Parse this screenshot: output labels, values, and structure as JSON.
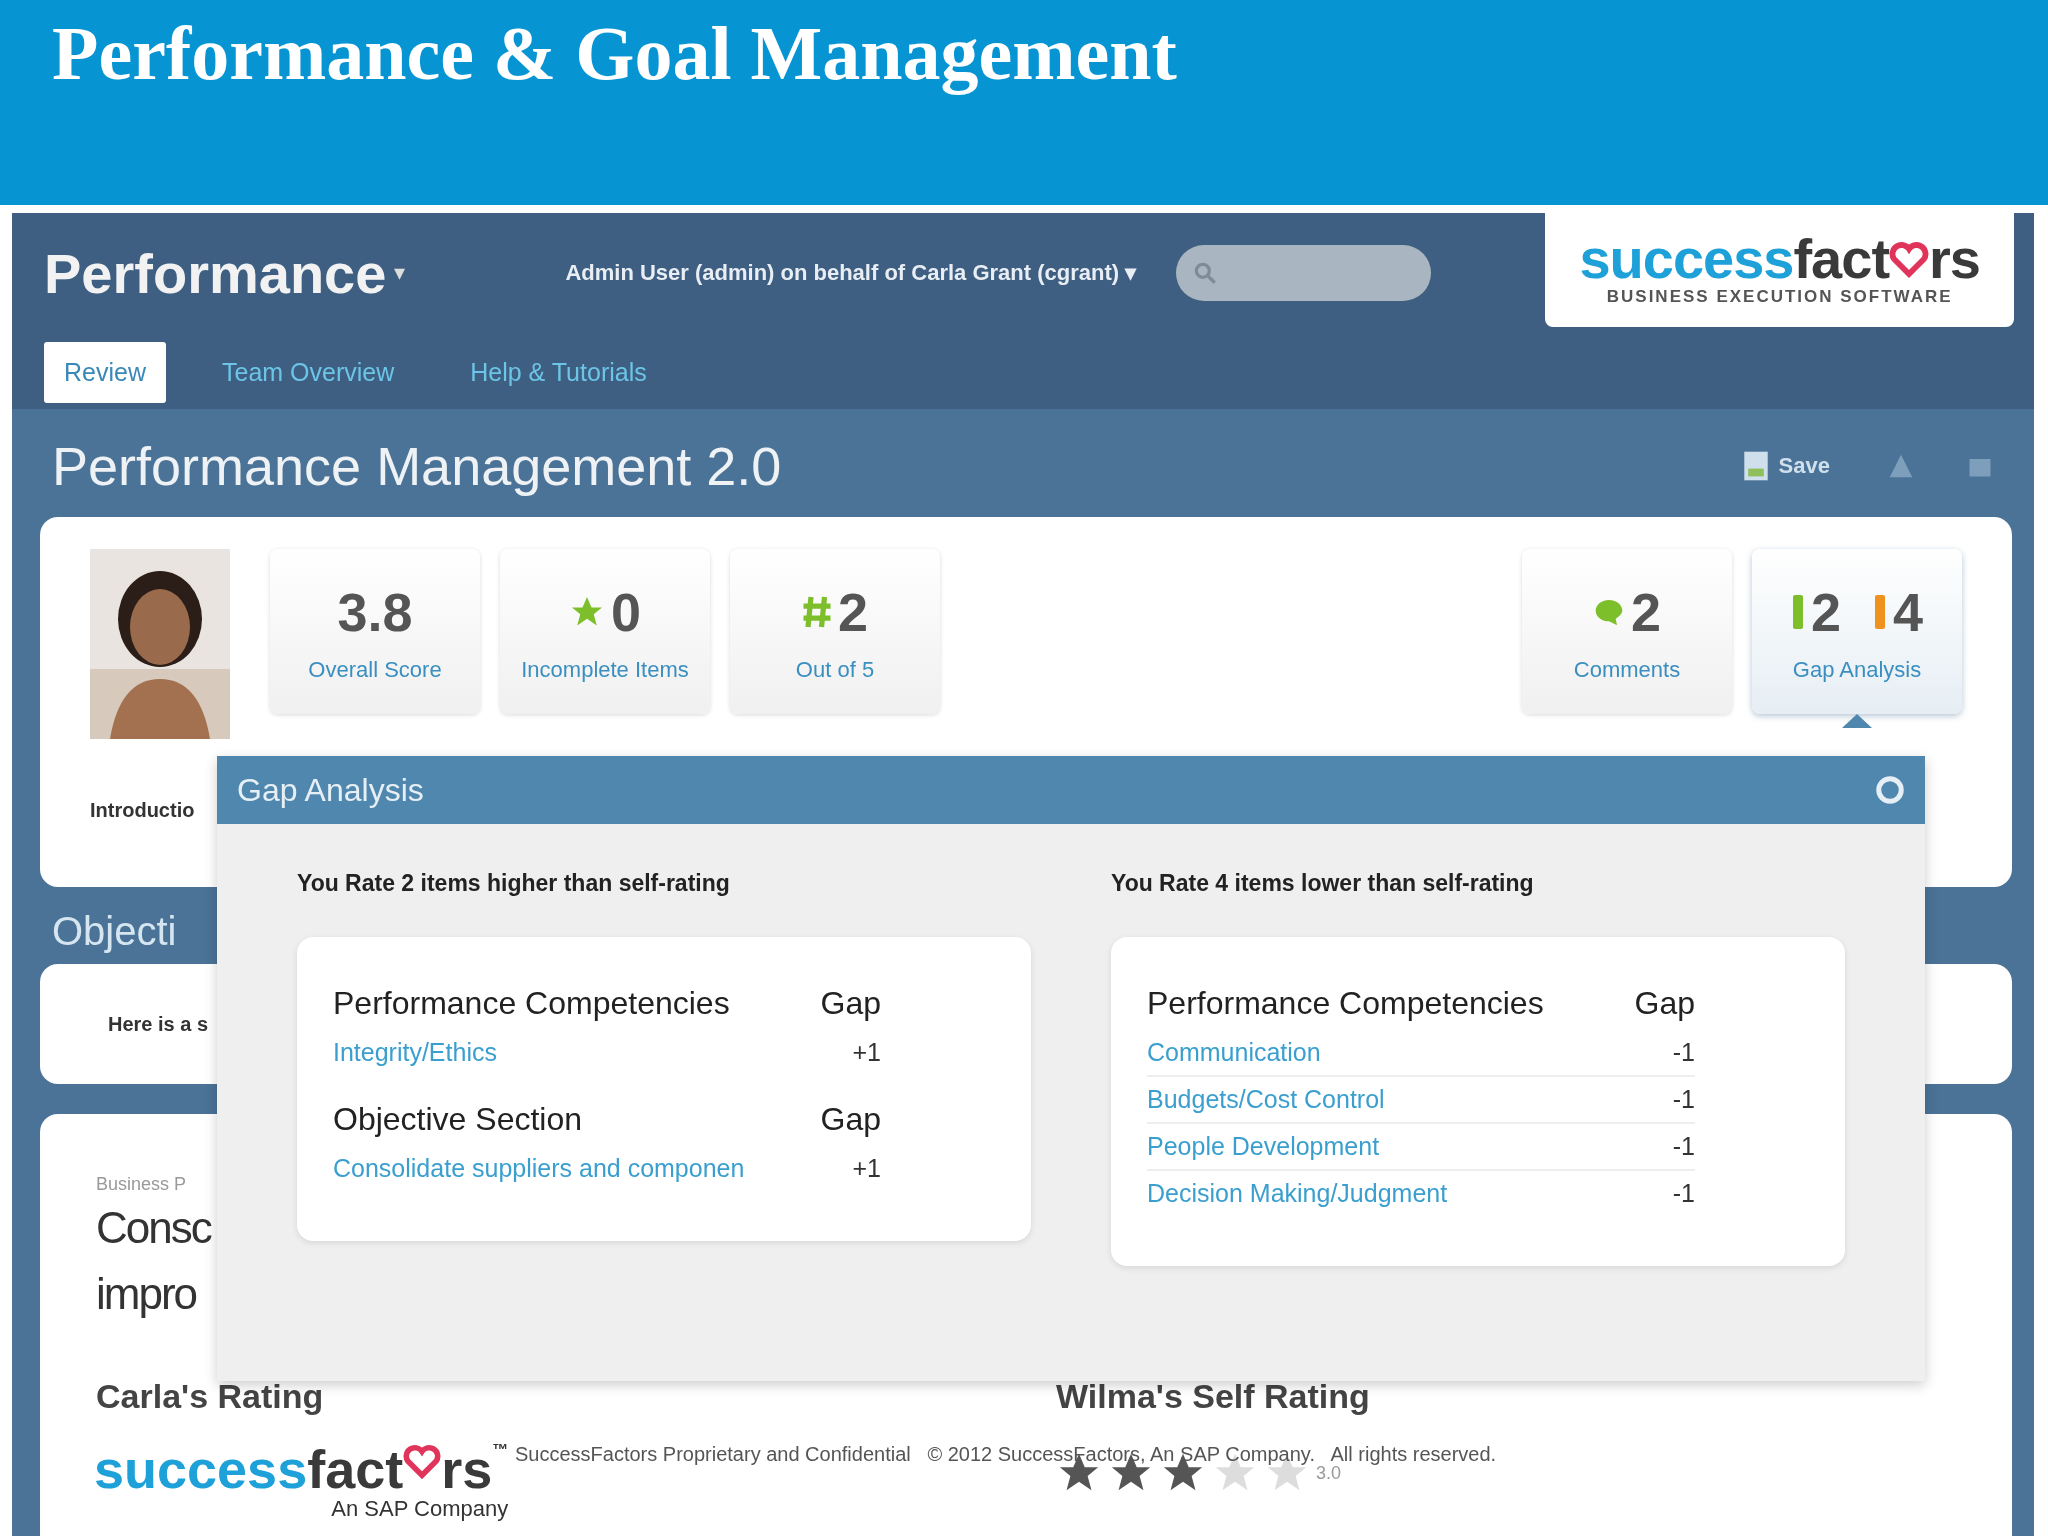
{
  "slide_title": "Performance & Goal Management",
  "app": {
    "module": "Performance",
    "module_caret": "▾",
    "user_menu": "Admin User (admin) on behalf of Carla Grant (cgrant)",
    "user_caret": "▾",
    "logo": {
      "part_1": "success",
      "part_2": "fact",
      "part_3": "rs",
      "tagline": "BUSINESS EXECUTION SOFTWARE"
    },
    "tabs": [
      {
        "label": "Review",
        "selected": true
      },
      {
        "label": "Team Overview",
        "selected": false
      },
      {
        "label": "Help & Tutorials",
        "selected": false
      }
    ],
    "page_title": "Performance Management 2.0",
    "save_action": "Save",
    "tiles_left": [
      {
        "kind": "plain",
        "value": "3.8",
        "label": "Overall Score"
      },
      {
        "kind": "star",
        "value": "0",
        "label": "Incomplete Items"
      },
      {
        "kind": "hash",
        "value": "2",
        "label": "Out of 5"
      }
    ],
    "tiles_right": [
      {
        "kind": "comment",
        "value": "2",
        "label": "Comments",
        "selected": false
      },
      {
        "kind": "gap",
        "value": "2",
        "value_2": "4",
        "label": "Gap Analysis",
        "selected": true
      }
    ],
    "intro_label": "Introductio",
    "objectives_heading": "Objecti",
    "objectives_text": "Here is a s",
    "bottom": {
      "caption": "Business P",
      "title_line_1": "Consc",
      "title_line_2": "impro",
      "manager_rating": "Carla's Rating",
      "self_rating": "Wilma's Self Rating",
      "stars": 3,
      "score": "3.0"
    },
    "popup": {
      "title": "Gap Analysis",
      "panels": [
        {
          "heading": "You Rate 2 items higher than self-rating",
          "groups": [
            {
              "section": "Performance Competencies",
              "gap_label": "Gap",
              "items": [
                {
                  "name": "Integrity/Ethics",
                  "gap": "+1"
                }
              ]
            },
            {
              "section": "Objective Section",
              "gap_label": "Gap",
              "items": [
                {
                  "name": "Consolidate suppliers and componen",
                  "gap": "+1"
                }
              ]
            }
          ]
        },
        {
          "heading": "You Rate 4 items lower than self-rating",
          "groups": [
            {
              "section": "Performance Competencies",
              "gap_label": "Gap",
              "items": [
                {
                  "name": "Communication",
                  "gap": "-1"
                },
                {
                  "name": "Budgets/Cost Control",
                  "gap": "-1"
                },
                {
                  "name": "People Development",
                  "gap": "-1"
                },
                {
                  "name": "Decision Making/Judgment",
                  "gap": "-1"
                }
              ]
            }
          ]
        }
      ]
    }
  },
  "footer": {
    "logo_1": "success",
    "logo_2": "fact",
    "logo_3": "rs",
    "trademark": "™",
    "logo_sub": "An SAP Company",
    "notice": "SuccessFactors Proprietary and Confidential   © 2012 SuccessFactors, An SAP Company.   All rights reserved."
  }
}
